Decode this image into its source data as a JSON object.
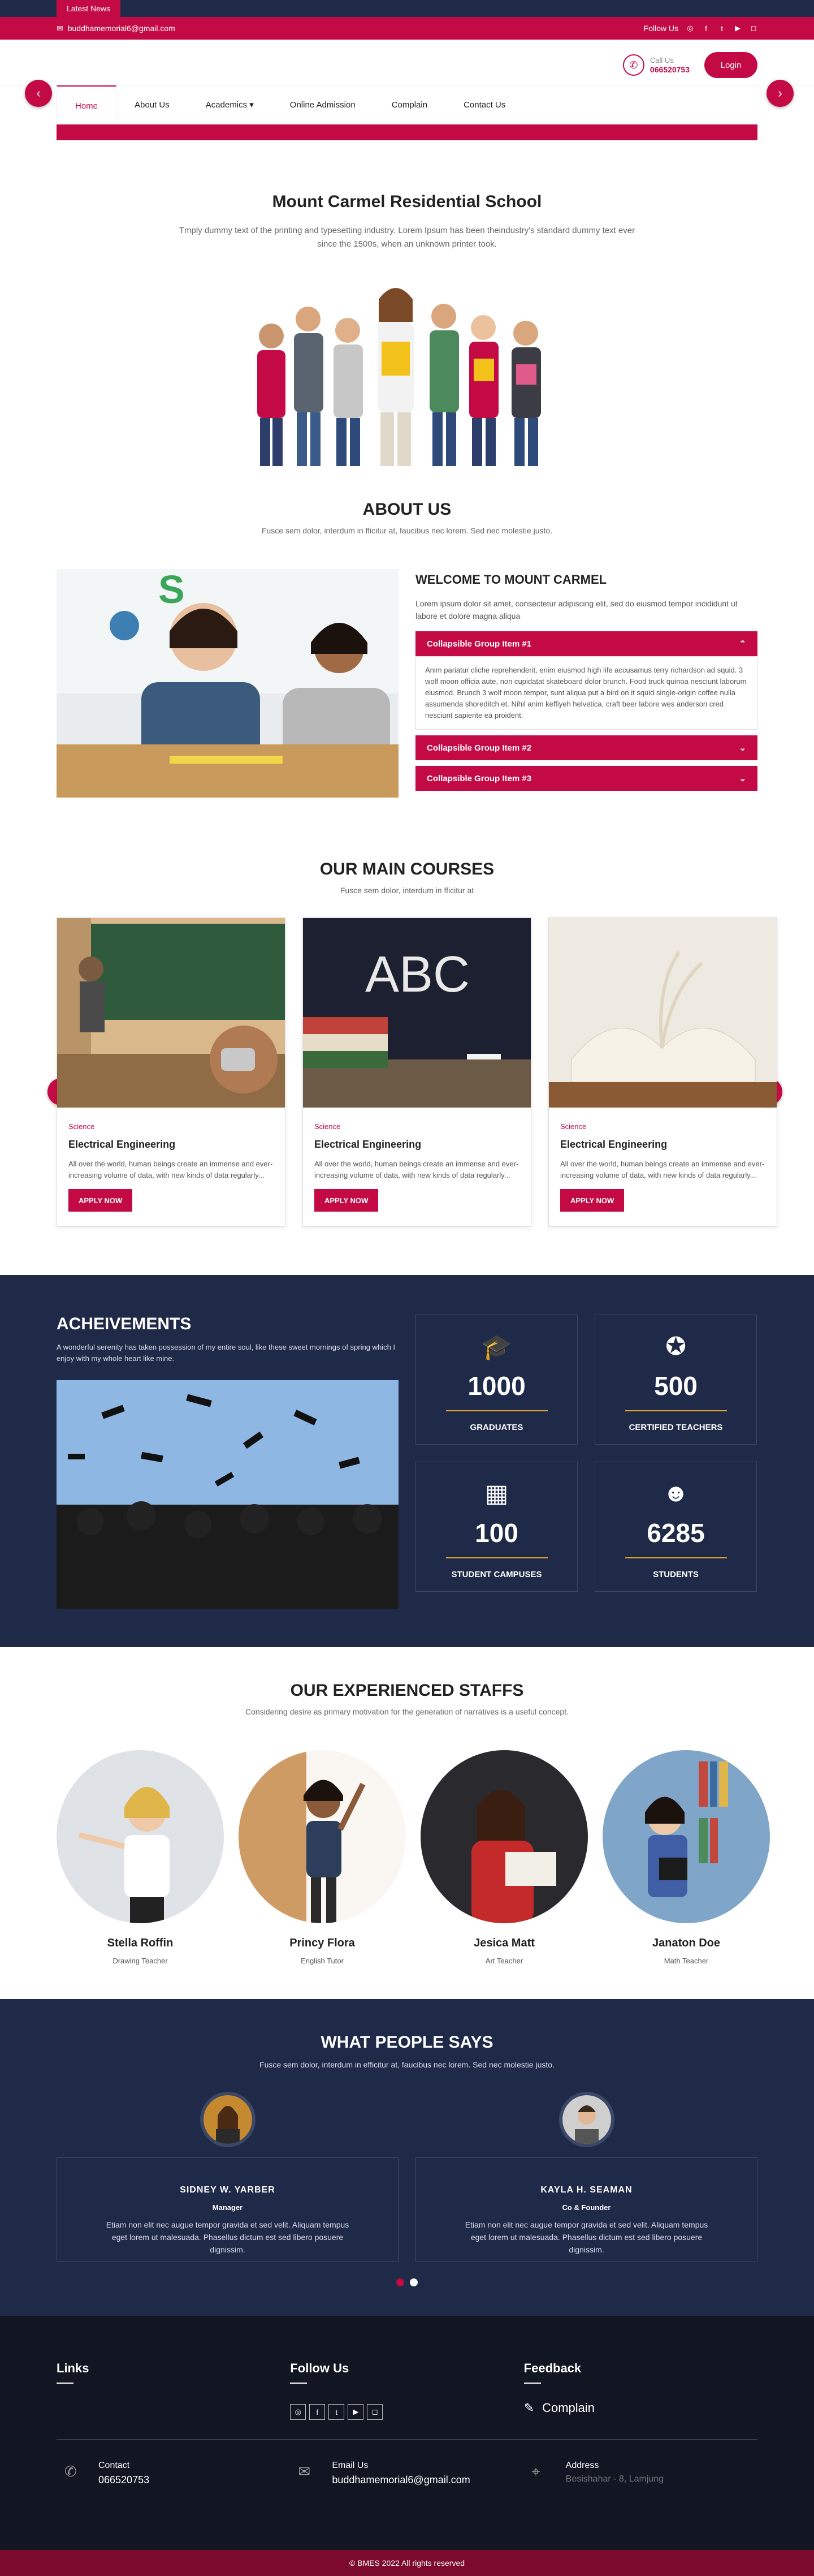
{
  "topbar": {
    "news_label": "Latest News",
    "email": "buddhamemorial6@gmail.com",
    "follow_label": "Follow Us",
    "social_icons": [
      "whatsapp-icon",
      "facebook-icon",
      "twitter-icon",
      "youtube-icon",
      "instagram-icon"
    ]
  },
  "header": {
    "call_label": "Call Us",
    "phone": "066520753",
    "login_label": "Login"
  },
  "nav": {
    "items": [
      "Home",
      "About Us",
      "Academics ▾",
      "Online Admission",
      "Complain",
      "Contact Us"
    ],
    "active": "Home"
  },
  "hero": {
    "title": "Mount Carmel Residential School",
    "text": "Tmply dummy text of the printing and typesetting industry. Lorem Ipsum has been theindustry's standard dummy text ever since the 1500s, when an unknown printer took."
  },
  "about": {
    "title": "ABOUT US",
    "subtitle": "Fusce sem dolor, interdum in fficitur at, faucibus nec lorem. Sed nec molestie justo.",
    "heading": "WELCOME TO MOUNT CARMEL",
    "lead": "Lorem ipsum dolor sit amet, consectetur adipiscing elit, sed do eiusmod tempor incididunt ut labore et dolore magna aliqua",
    "accordion": [
      {
        "title": "Collapsible Group Item #1",
        "body": "Anim pariatur cliche reprehenderit, enim eiusmod high life accusamus terry richardson ad squid. 3 wolf moon officia aute, non cupidatat skateboard dolor brunch. Food truck quinoa nesciunt laborum eiusmod. Brunch 3 wolf moon tempor, sunt aliqua put a bird on it squid single-origin coffee nulla assumenda shoreditch et. Nihil anim keffiyeh helvetica, craft beer labore wes anderson cred nesciunt sapiente ea proident."
      },
      {
        "title": "Collapsible Group Item #2"
      },
      {
        "title": "Collapsible Group Item #3"
      }
    ]
  },
  "courses": {
    "title": "OUR MAIN COURSES",
    "subtitle": "Fusce sem dolor, interdum in fficitur at",
    "items": [
      {
        "category": "Science",
        "title": "Electrical Engineering",
        "desc": "All over the world, human beings create an immense and ever-increasing volume of data, with new kinds of data regularly...",
        "button": "APPLY NOW"
      },
      {
        "category": "Science",
        "title": "Electrical Engineering",
        "desc": "All over the world, human beings create an immense and ever-increasing volume of data, with new kinds of data regularly...",
        "button": "APPLY NOW"
      },
      {
        "category": "Science",
        "title": "Electrical Engineering",
        "desc": "All over the world, human beings create an immense and ever-increasing volume of data, with new kinds of data regularly...",
        "button": "APPLY NOW"
      }
    ]
  },
  "achievements": {
    "title": "ACHEIVEMENTS",
    "text": "A wonderful serenity has taken possession of my entire soul, like these sweet mornings of spring which I enjoy with my whole heart like mine.",
    "stats": [
      {
        "icon": "graduation-cap-icon",
        "value": "1000",
        "label": "GRADUATES"
      },
      {
        "icon": "award-icon",
        "value": "500",
        "label": "CERTIFIED TEACHERS"
      },
      {
        "icon": "building-icon",
        "value": "100",
        "label": "STUDENT CAMPUSES"
      },
      {
        "icon": "student-icon",
        "value": "6285",
        "label": "STUDENTS"
      }
    ]
  },
  "staff": {
    "title": "OUR EXPERIENCED STAFFS",
    "subtitle": "Considering desire as primary motivation for the generation of narratives is a useful concept.",
    "members": [
      {
        "name": "Stella Roffin",
        "role": "Drawing Teacher"
      },
      {
        "name": "Princy Flora",
        "role": "English Tutor"
      },
      {
        "name": "Jesica Matt",
        "role": "Art Teacher"
      },
      {
        "name": "Janaton Doe",
        "role": "Math Teacher"
      }
    ]
  },
  "testimonials": {
    "title": "WHAT PEOPLE SAYS",
    "subtitle": "Fusce sem dolor, interdum in efficitur at, faucibus nec lorem. Sed nec molestie justo.",
    "items": [
      {
        "name": "SIDNEY W. YARBER",
        "role": "Manager",
        "text": "Etiam non elit nec augue tempor gravida et sed velit. Aliquam tempus eget lorem ut malesuada. Phasellus dictum est sed libero posuere dignissim."
      },
      {
        "name": "KAYLA H. SEAMAN",
        "role": "Co & Founder",
        "text": "Etiam non elit nec augue tempor gravida et sed velit. Aliquam tempus eget lorem ut malesuada. Phasellus dictum est sed libero posuere dignissim."
      }
    ]
  },
  "footer": {
    "links_title": "Links",
    "follow_title": "Follow Us",
    "feedback_title": "Feedback",
    "complain_label": "Complain",
    "contact": [
      {
        "icon": "phone-icon",
        "title": "Contact",
        "value": "066520753"
      },
      {
        "icon": "email-icon",
        "title": "Email Us",
        "value": "buddhamemorial6@gmail.com"
      },
      {
        "icon": "location-icon",
        "title": "Address",
        "value": "Besishahar - 8, Lamjung"
      }
    ],
    "copyright": "© BMES 2022 All rights reserved"
  },
  "colors": {
    "brand": "#c40a45",
    "navy": "#1e2a47",
    "gold": "#e1a52a"
  }
}
